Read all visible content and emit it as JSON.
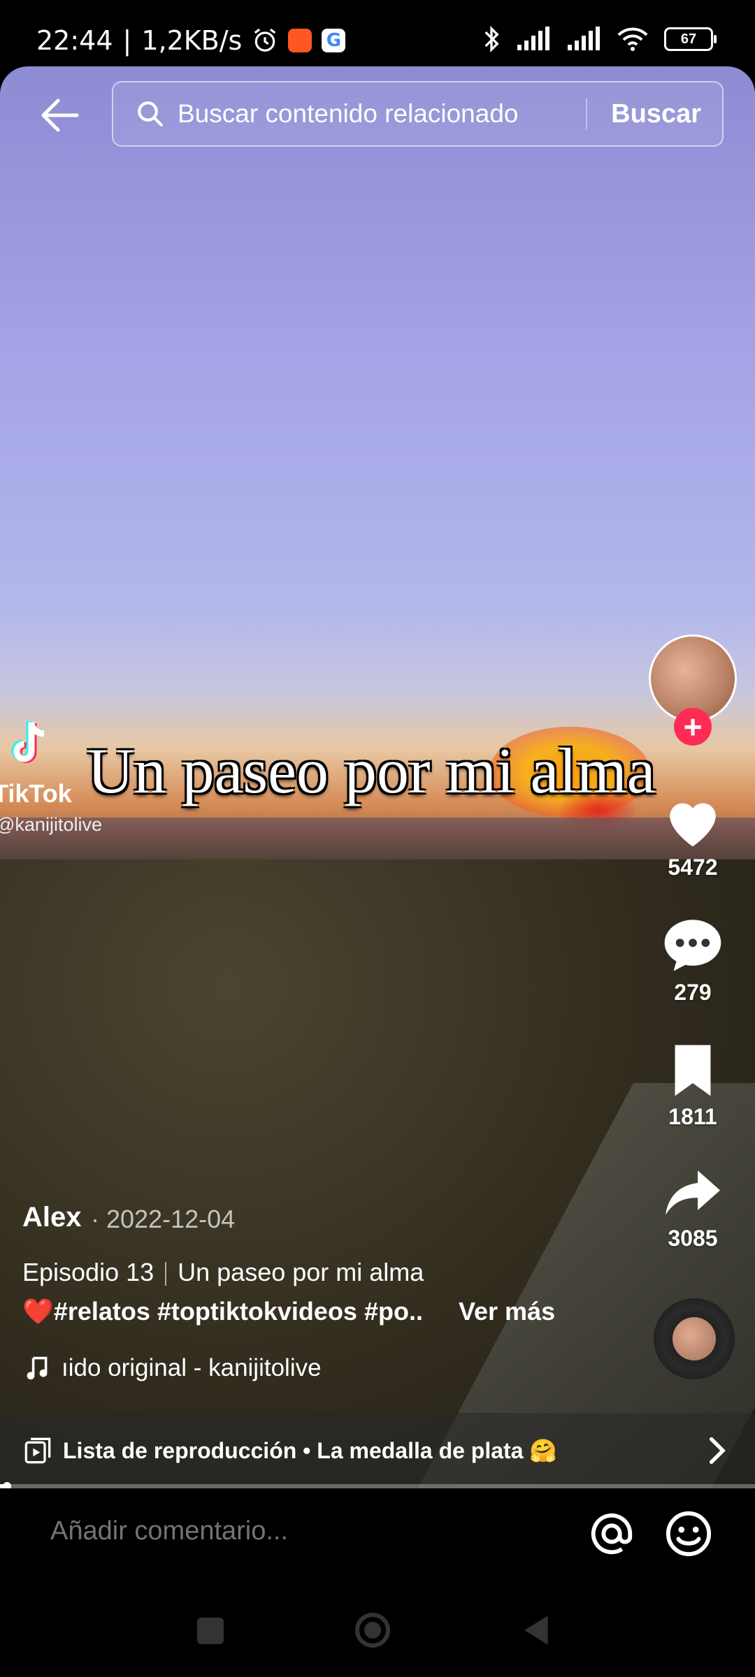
{
  "status_bar": {
    "time": "22:44",
    "network_speed": "1,2KB/s",
    "battery": "67",
    "icons": [
      "alarm-icon",
      "video-app-icon",
      "google-icon",
      "bluetooth-icon",
      "signal-icon",
      "signal-icon",
      "wifi-icon",
      "battery-icon"
    ]
  },
  "search": {
    "placeholder": "Buscar contenido relacionado",
    "button": "Buscar"
  },
  "video": {
    "watermark_brand": "TikTok",
    "watermark_user": "@kanijitolive",
    "overlay_title": "Un paseo por mi alma"
  },
  "actions": {
    "likes": "5472",
    "comments": "279",
    "saves": "1811",
    "shares": "3085",
    "follow_plus": "+"
  },
  "post": {
    "author": "Alex",
    "date": "· 2022-12-04",
    "episode": "Episodio 13",
    "episode_title": "Un paseo por mi alma",
    "hashtags": "❤️#relatos #toptiktokvideos #po..",
    "see_more": "Ver más",
    "sound": "ıido original - kanijitolive"
  },
  "playlist": {
    "label": "Lista de reproducción • La medalla de plata 🤗"
  },
  "comment": {
    "placeholder": "Añadir comentario..."
  },
  "colors": {
    "accent": "#fe2c55"
  }
}
